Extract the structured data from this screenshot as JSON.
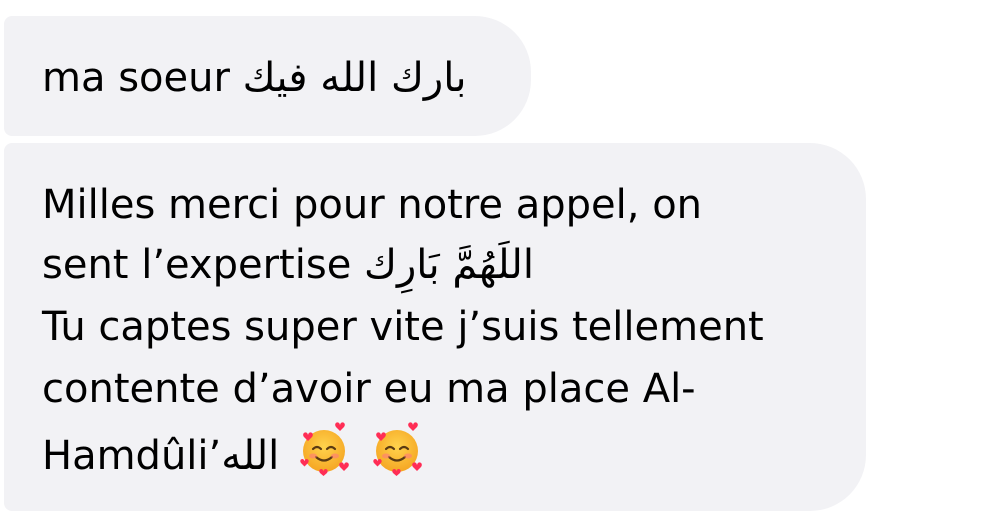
{
  "messages": [
    {
      "lines": [
        "ma soeur بارك الله فيك"
      ]
    },
    {
      "lines": [
        "Milles merci pour notre appel, on",
        "sent l’expertise اللَهُمَّ بَارِك",
        "Tu captes super vite j’suis tellement",
        "contente d’avoir eu ma place Al-",
        "Hamdûli’الله"
      ],
      "emojis": [
        "smiling-face-with-hearts-icon",
        "smiling-face-with-hearts-icon"
      ]
    }
  ],
  "colors": {
    "bubble_background": "#f2f2f5",
    "text": "#000000"
  }
}
